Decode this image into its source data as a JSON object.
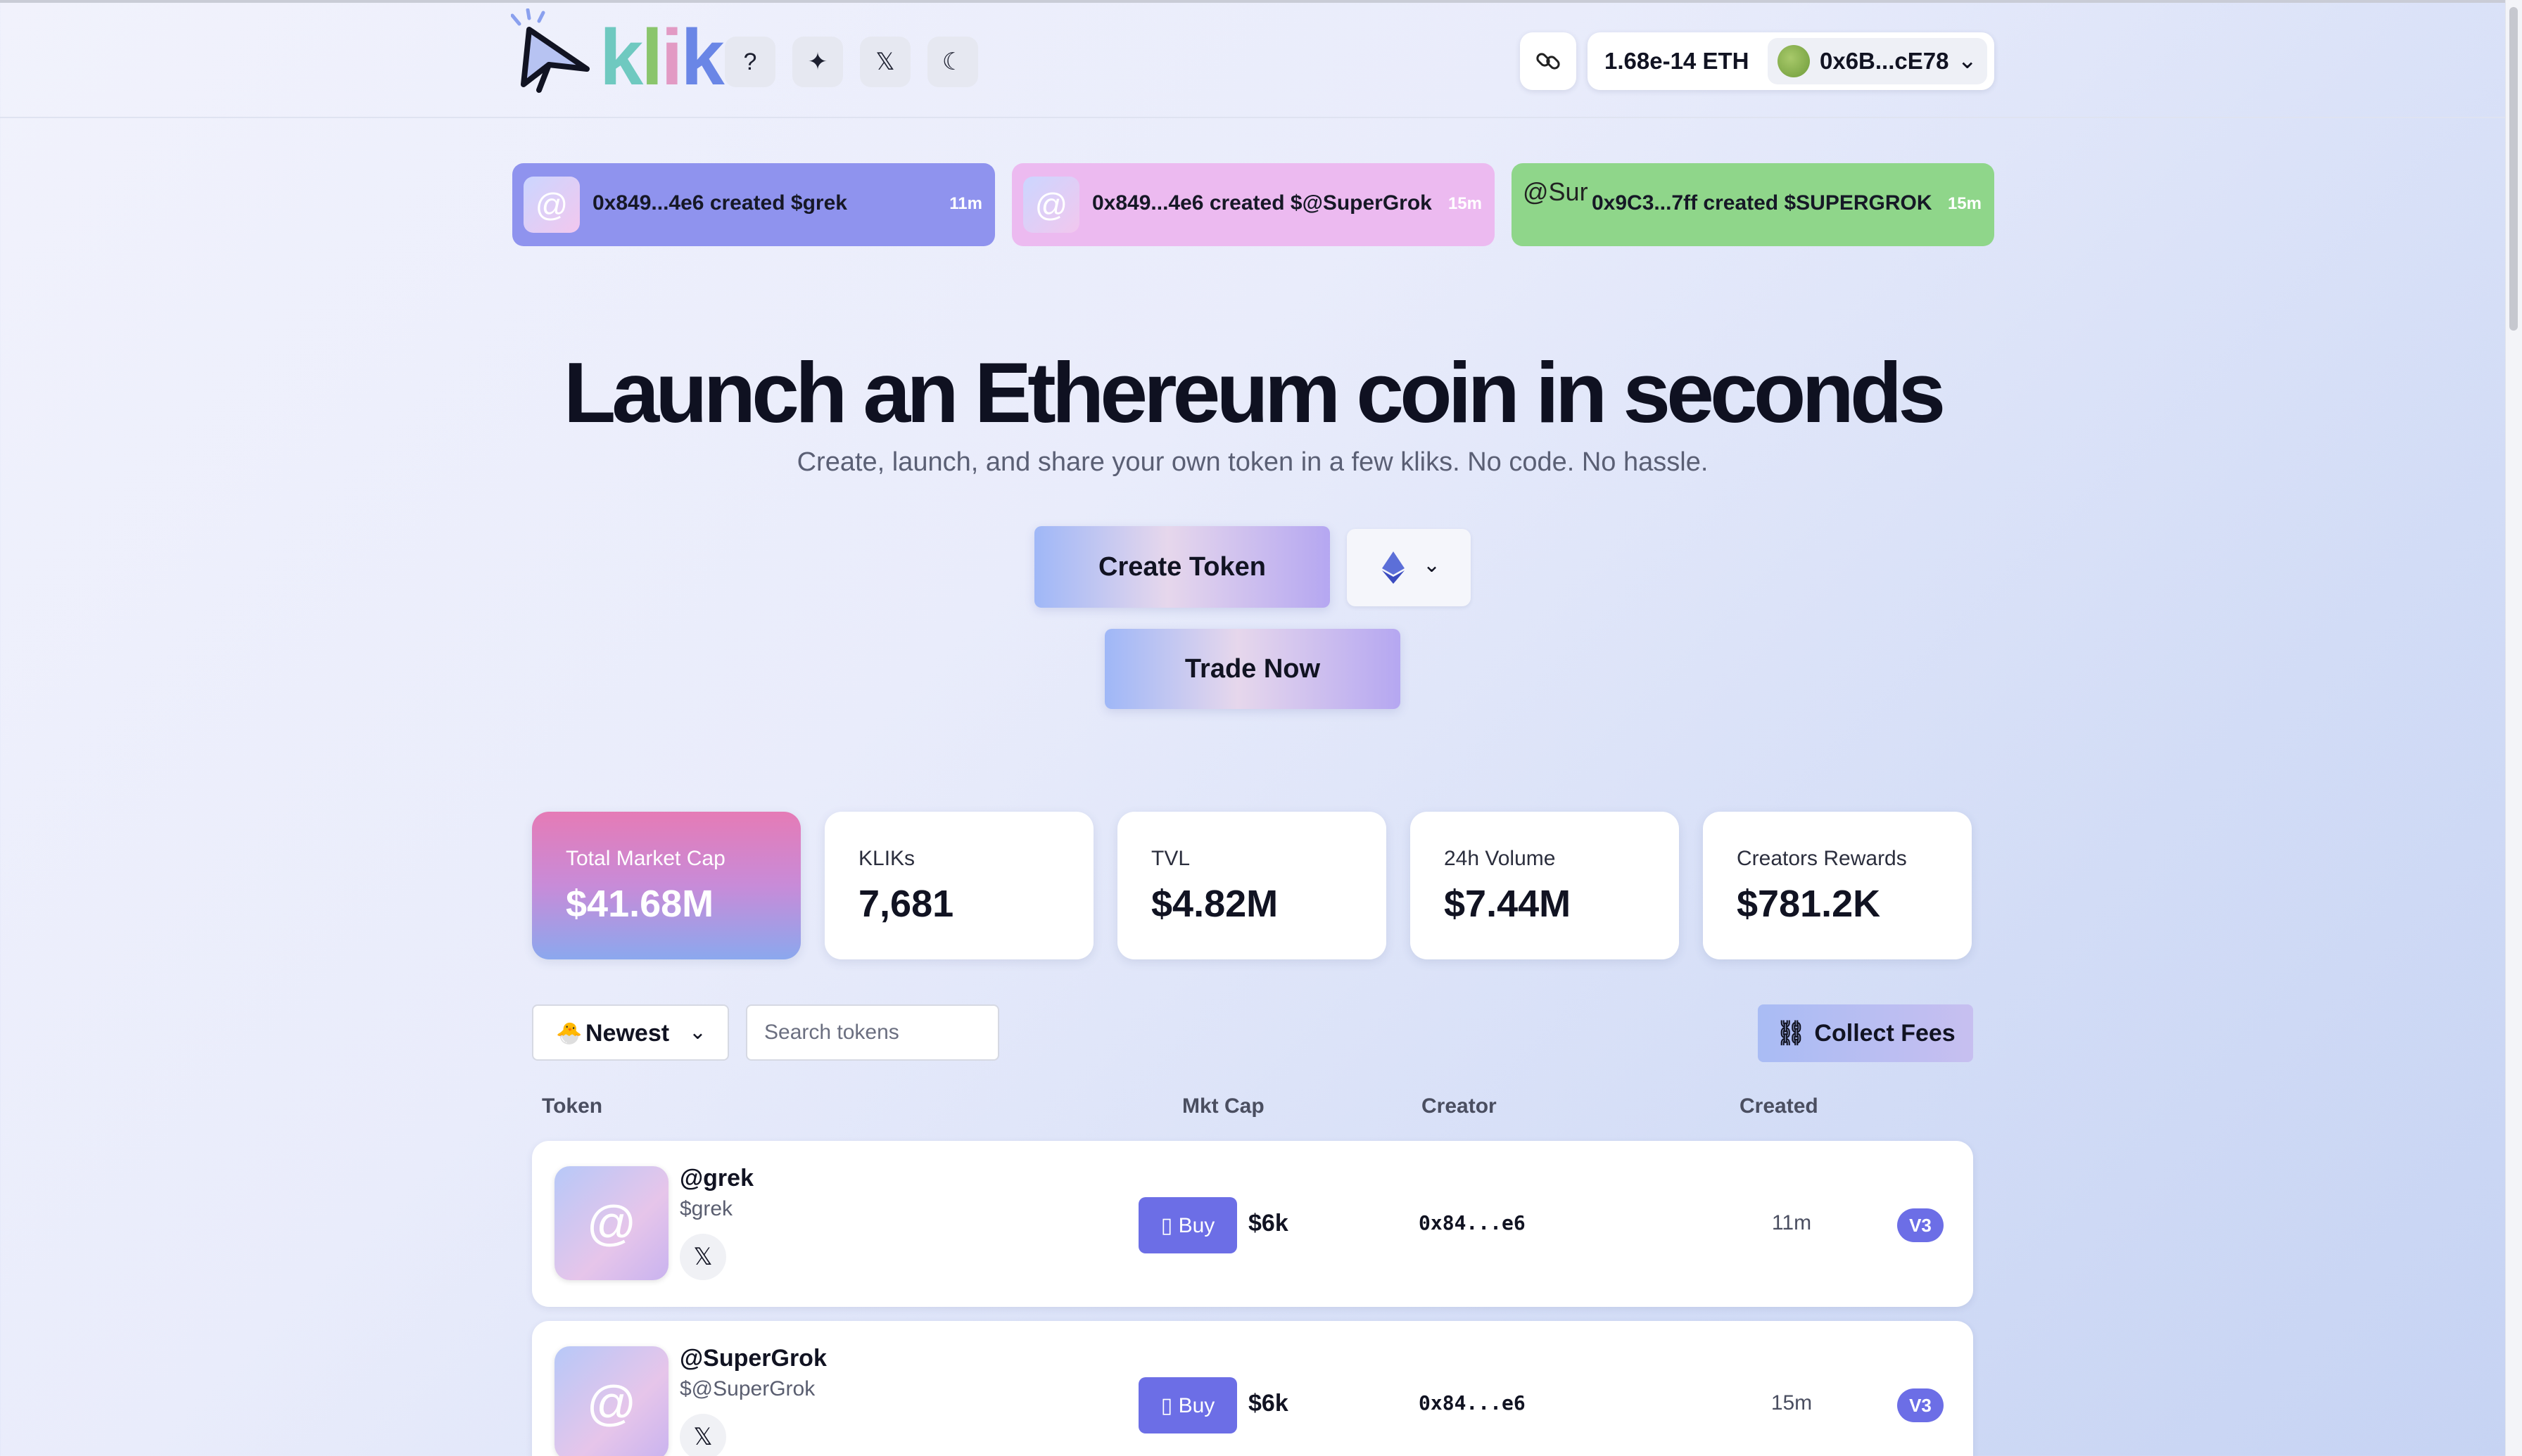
{
  "header": {
    "logo_text": [
      "k",
      "l",
      "i",
      "k"
    ],
    "icons": [
      "help-icon",
      "confetti-icon",
      "x-logo-icon",
      "moon-icon"
    ],
    "eth_balance": "1.68e-14 ETH",
    "wallet_address": "0x6B...cE78"
  },
  "ticker": [
    {
      "text": "0x849...4e6 created $grek",
      "time": "11m",
      "color": "#8f93ee"
    },
    {
      "text": "0x849...4e6 created $@SuperGrok",
      "time": "15m",
      "color": "#ecbaf0"
    },
    {
      "text": "0x9C3...7ff created $SUPERGROK",
      "time": "15m",
      "color": "#8fd68a",
      "avatar_alt": "@Sur"
    }
  ],
  "hero": {
    "title": "Launch an Ethereum coin in seconds",
    "subtitle": "Create, launch, and share your own token in a few kliks. No code. No hassle.",
    "create_label": "Create Token",
    "trade_label": "Trade Now"
  },
  "stats": [
    {
      "label": "Total Market Cap",
      "value": "$41.68M"
    },
    {
      "label": "KLIKs",
      "value": "7,681"
    },
    {
      "label": "TVL",
      "value": "$4.82M"
    },
    {
      "label": "24h Volume",
      "value": "$7.44M"
    },
    {
      "label": "Creators Rewards",
      "value": "$781.2K"
    }
  ],
  "controls": {
    "sort_label": "Newest",
    "search_placeholder": "Search tokens",
    "collect_label": "Collect Fees"
  },
  "table": {
    "columns": [
      "Token",
      "Mkt Cap",
      "Creator",
      "Created"
    ],
    "rows": [
      {
        "name": "@grek",
        "symbol": "$grek",
        "buy": "Buy",
        "mcap": "$6k",
        "creator": "0x84...e6",
        "created": "11m",
        "version": "V3"
      },
      {
        "name": "@SuperGrok",
        "symbol": "$@SuperGrok",
        "buy": "Buy",
        "mcap": "$6k",
        "creator": "0x84...e6",
        "created": "15m",
        "version": "V3"
      }
    ]
  }
}
